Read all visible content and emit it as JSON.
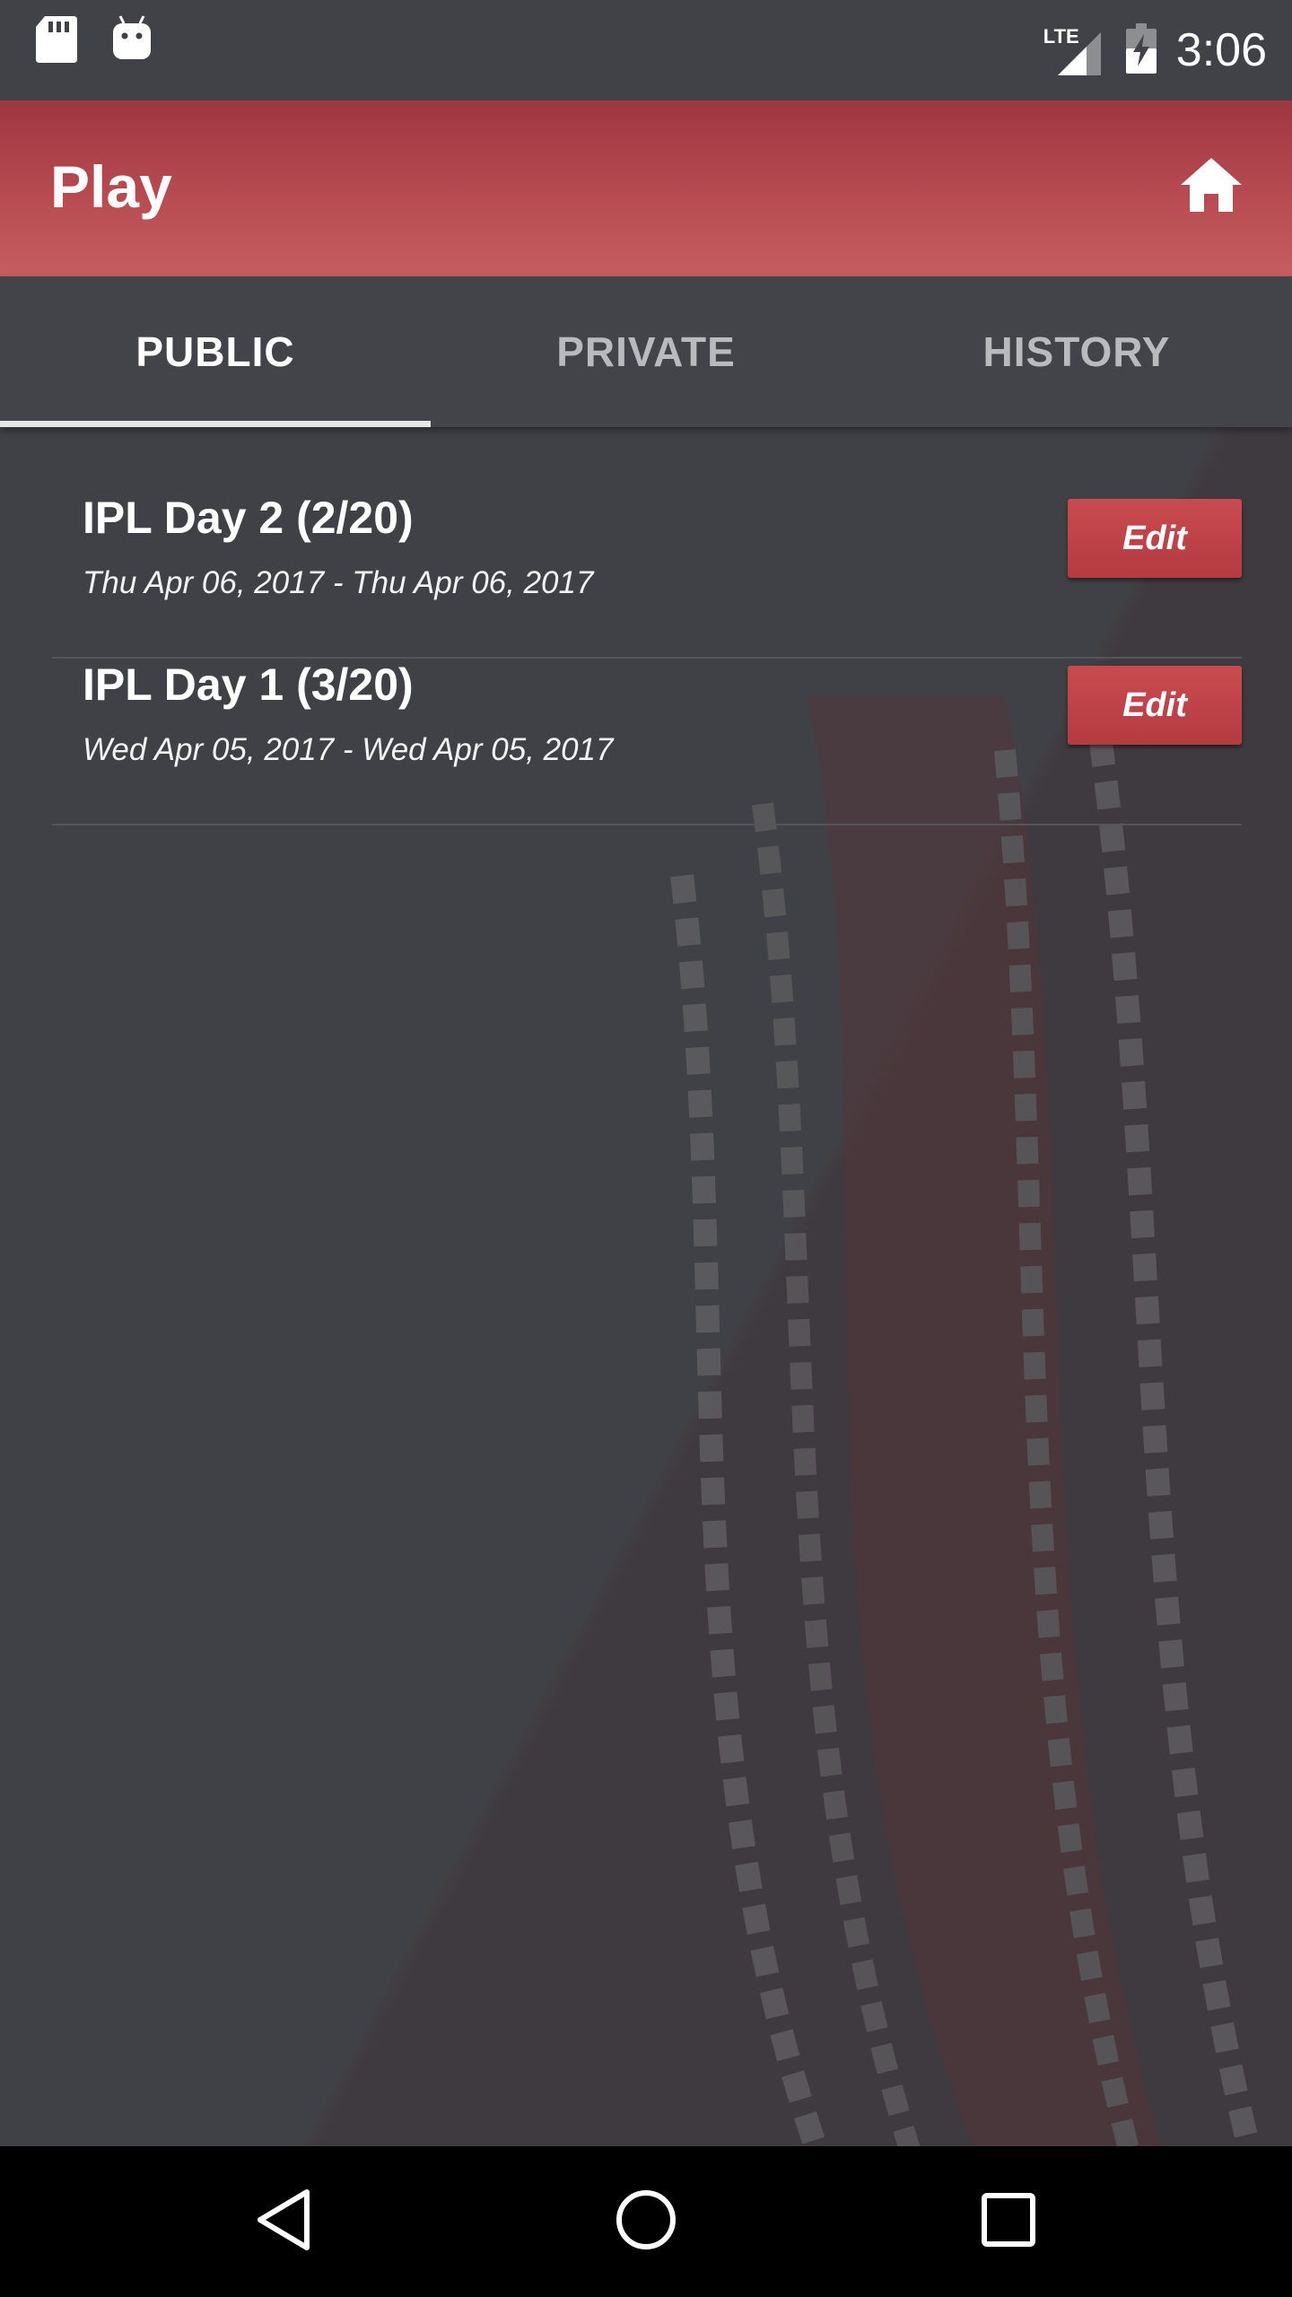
{
  "status_bar": {
    "time": "3:06",
    "network_label": "LTE",
    "icons": [
      "sd-card-icon",
      "android-icon",
      "signal-icon",
      "battery-charging-icon"
    ]
  },
  "app_bar": {
    "title": "Play",
    "home_icon": "home-icon"
  },
  "tabs": [
    {
      "label": "PUBLIC",
      "active": true
    },
    {
      "label": "PRIVATE",
      "active": false
    },
    {
      "label": "HISTORY",
      "active": false
    }
  ],
  "matches": [
    {
      "title": "IPL Day 2 (2/20)",
      "dates": "Thu Apr 06, 2017 - Thu Apr 06, 2017",
      "edit_label": "Edit"
    },
    {
      "title": "IPL Day 1 (3/20)",
      "dates": "Wed Apr 05, 2017 - Wed Apr 05, 2017",
      "edit_label": "Edit"
    }
  ],
  "nav_bar": {
    "icons": [
      "back-icon",
      "home-circle-icon",
      "recents-icon"
    ]
  },
  "colors": {
    "accent": "#b43b40",
    "app_bar": "#b84b52",
    "background": "#404146",
    "nav_bar": "#000000"
  }
}
